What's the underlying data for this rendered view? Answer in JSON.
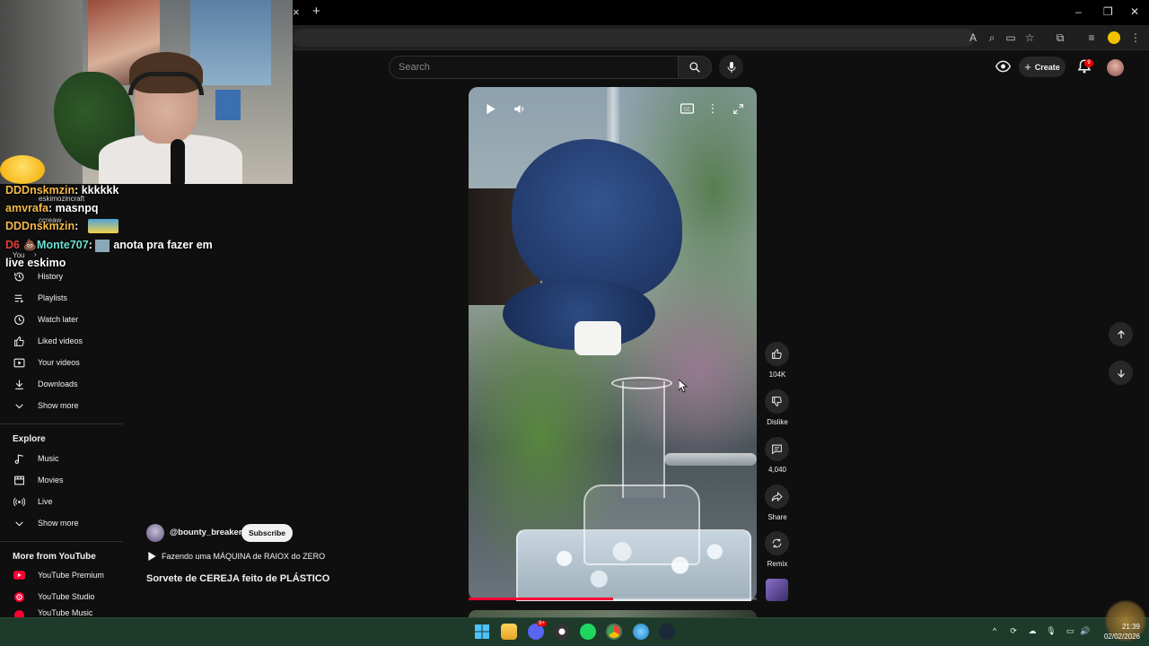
{
  "browser": {
    "new_tab_symbol": "+",
    "close_tab_symbol": "×",
    "window_controls": {
      "minimize": "–",
      "restore": "❐",
      "close": "✕"
    }
  },
  "header": {
    "search_placeholder": "Search",
    "create_label": "Create",
    "notification_count": "9"
  },
  "chat": [
    {
      "name": "DDDnskmzin",
      "message": "kkkkkk",
      "sub": "eskimozincraft"
    },
    {
      "name": "amvrafa",
      "message": "masnpq",
      "sub": "ccreaw"
    },
    {
      "name": "DDDnskmzin",
      "message": "",
      "sub": ""
    },
    {
      "name": "Monte707",
      "message": "anota pra fazer em",
      "continuation": "live eskimo",
      "badges": "D6 💩"
    }
  ],
  "sidebar": {
    "you_label": "You",
    "you_items": [
      {
        "label": "History",
        "icon": "history-icon"
      },
      {
        "label": "Playlists",
        "icon": "playlists-icon"
      },
      {
        "label": "Watch later",
        "icon": "clock-icon"
      },
      {
        "label": "Liked videos",
        "icon": "thumbs-up-icon"
      },
      {
        "label": "Your videos",
        "icon": "video-icon"
      },
      {
        "label": "Downloads",
        "icon": "download-icon"
      },
      {
        "label": "Show more",
        "icon": "chevron-down-icon"
      }
    ],
    "explore_heading": "Explore",
    "explore_items": [
      {
        "label": "Music",
        "icon": "music-note-icon"
      },
      {
        "label": "Movies",
        "icon": "film-icon"
      },
      {
        "label": "Live",
        "icon": "live-icon"
      },
      {
        "label": "Show more",
        "icon": "chevron-down-icon"
      }
    ],
    "more_heading": "More from YouTube",
    "more_items": [
      {
        "label": "YouTube Premium",
        "icon": "youtube-premium-icon"
      },
      {
        "label": "YouTube Studio",
        "icon": "youtube-studio-icon"
      },
      {
        "label": "YouTube Music",
        "icon": "youtube-music-icon"
      }
    ]
  },
  "short": {
    "channel": "@bounty_breaker",
    "subscribe_label": "Subscribe",
    "playlist_title": "Fazendo uma MÁQUINA de RAIOX do ZERO",
    "title": "Sorvete de CEREJA feito de PLÁSTICO",
    "progress": 0.5,
    "likes": "104K",
    "dislike_label": "Dislike",
    "comments": "4,040",
    "share_label": "Share",
    "remix_label": "Remix"
  },
  "taskbar": {
    "time": "21:39",
    "date": "02/02/2026",
    "discord_badge": "9+"
  },
  "colors": {
    "accent_red": "#ff0033",
    "chat_name": "#f5b94a",
    "chat_name_alt": "#6ce0d0",
    "taskbar": "#1e3a2a"
  }
}
